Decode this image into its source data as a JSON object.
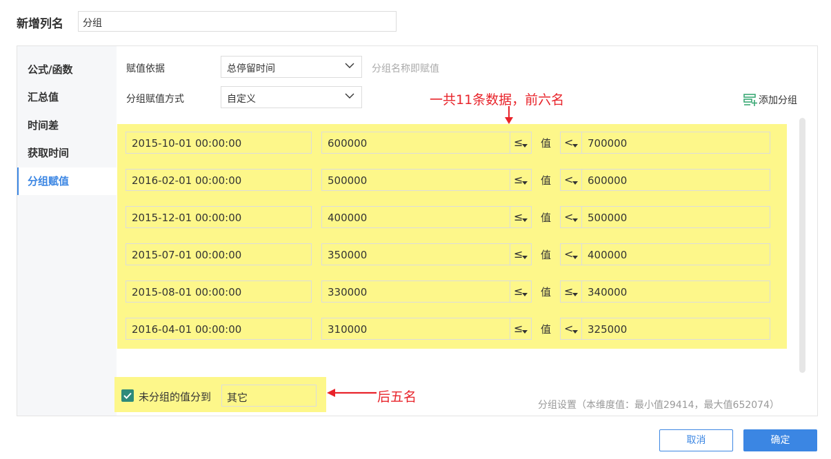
{
  "header": {
    "title": "新增列名",
    "name_value": "分组"
  },
  "sidebar": {
    "items": [
      {
        "label": "公式/函数",
        "active": false
      },
      {
        "label": "汇总值",
        "active": false
      },
      {
        "label": "时间差",
        "active": false
      },
      {
        "label": "获取时间",
        "active": false
      },
      {
        "label": "分组赋值",
        "active": true
      }
    ]
  },
  "form": {
    "basis_label": "赋值依据",
    "basis_value": "总停留时间",
    "basis_hint": "分组名称即赋值",
    "method_label": "分组赋值方式",
    "method_value": "自定义",
    "add_group_label": "添加分组"
  },
  "annotations": {
    "top": "一共11条数据，前六名",
    "bottom": "后五名",
    "accent_color": "#e8232a",
    "highlight_color": "#fdf78a"
  },
  "groups": [
    {
      "name": "2015-10-01 00:00:00",
      "min": "600000",
      "min_op": "≤",
      "value_label": "值",
      "max_op": "<",
      "max": "700000"
    },
    {
      "name": "2016-02-01 00:00:00",
      "min": "500000",
      "min_op": "≤",
      "value_label": "值",
      "max_op": "<",
      "max": "600000"
    },
    {
      "name": "2015-12-01 00:00:00",
      "min": "400000",
      "min_op": "≤",
      "value_label": "值",
      "max_op": "<",
      "max": "500000"
    },
    {
      "name": "2015-07-01 00:00:00",
      "min": "350000",
      "min_op": "≤",
      "value_label": "值",
      "max_op": "<",
      "max": "400000"
    },
    {
      "name": "2015-08-01 00:00:00",
      "min": "330000",
      "min_op": "≤",
      "value_label": "值",
      "max_op": "≤",
      "max": "340000"
    },
    {
      "name": "2016-04-01 00:00:00",
      "min": "310000",
      "min_op": "≤",
      "value_label": "值",
      "max_op": "<",
      "max": "325000"
    }
  ],
  "ungrouped": {
    "checked": true,
    "label": "未分组的值分到",
    "value": "其它"
  },
  "stats_text": "分组设置（本维度值：最小值29414，最大值652074）",
  "buttons": {
    "cancel": "取消",
    "ok": "确定",
    "primary_color": "#3b86e3"
  }
}
